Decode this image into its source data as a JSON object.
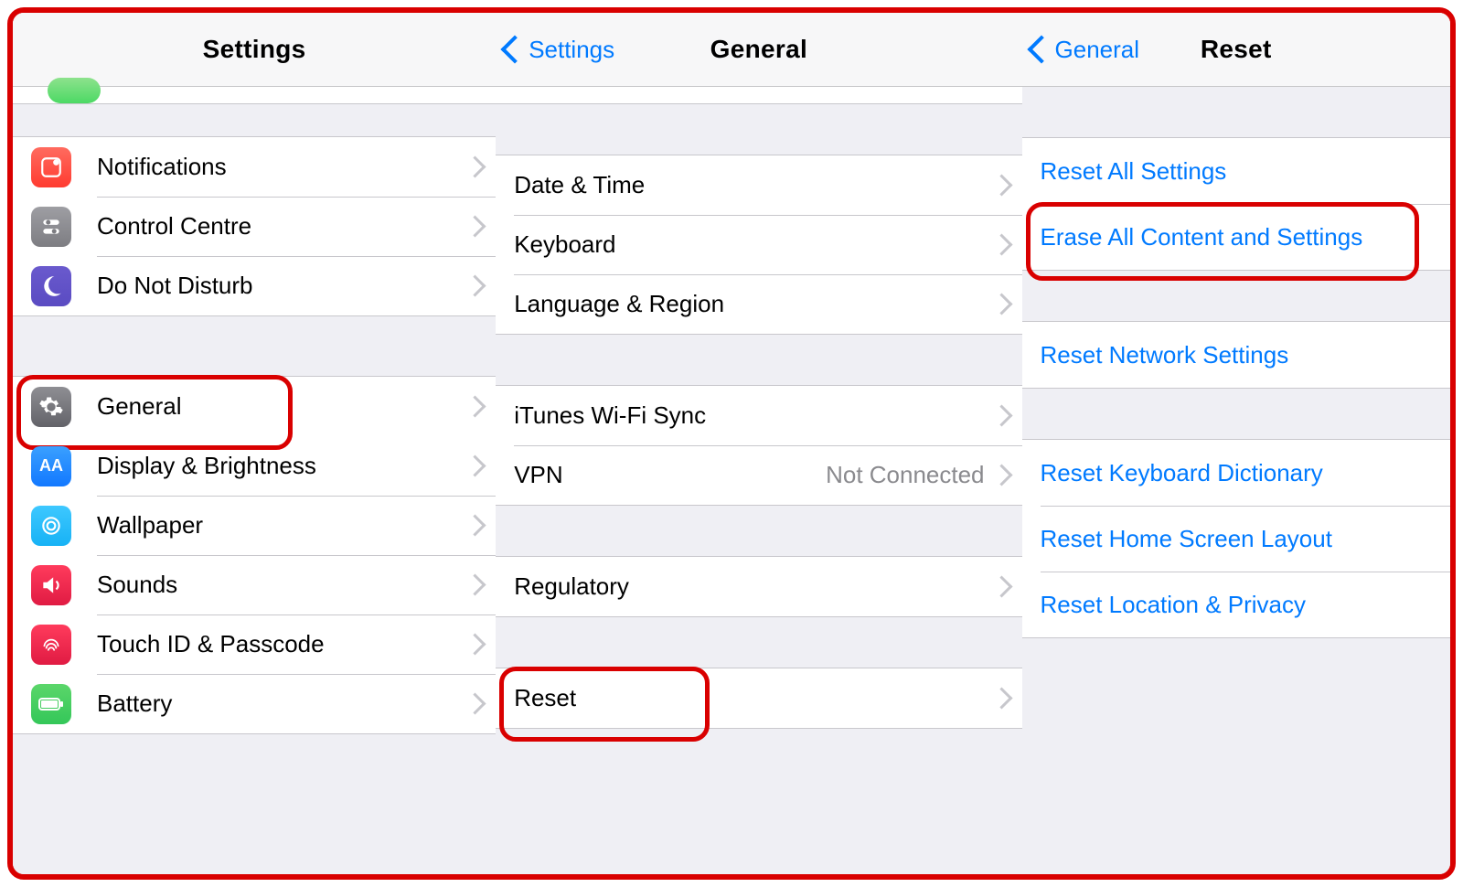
{
  "panel1": {
    "title": "Settings",
    "groupA": [
      {
        "label": "Notifications",
        "icon": "notifications-icon"
      },
      {
        "label": "Control Centre",
        "icon": "control-centre-icon"
      },
      {
        "label": "Do Not Disturb",
        "icon": "do-not-disturb-icon"
      }
    ],
    "groupB": [
      {
        "label": "General",
        "icon": "general-icon"
      },
      {
        "label": "Display & Brightness",
        "icon": "display-brightness-icon"
      },
      {
        "label": "Wallpaper",
        "icon": "wallpaper-icon"
      },
      {
        "label": "Sounds",
        "icon": "sounds-icon"
      },
      {
        "label": "Touch ID & Passcode",
        "icon": "touch-id-icon"
      },
      {
        "label": "Battery",
        "icon": "battery-icon"
      }
    ]
  },
  "panel2": {
    "back": "Settings",
    "title": "General",
    "groupA": [
      {
        "label": "Date & Time"
      },
      {
        "label": "Keyboard"
      },
      {
        "label": "Language & Region"
      }
    ],
    "groupB": [
      {
        "label": "iTunes Wi-Fi Sync"
      },
      {
        "label": "VPN",
        "value": "Not Connected"
      }
    ],
    "groupC": [
      {
        "label": "Regulatory"
      }
    ],
    "groupD": [
      {
        "label": "Reset"
      }
    ]
  },
  "panel3": {
    "back": "General",
    "title": "Reset",
    "groupA": [
      {
        "label": "Reset All Settings"
      },
      {
        "label": "Erase All Content and Settings"
      }
    ],
    "groupB": [
      {
        "label": "Reset Network Settings"
      }
    ],
    "groupC": [
      {
        "label": "Reset Keyboard Dictionary"
      },
      {
        "label": "Reset Home Screen Layout"
      },
      {
        "label": "Reset Location & Privacy"
      }
    ]
  }
}
